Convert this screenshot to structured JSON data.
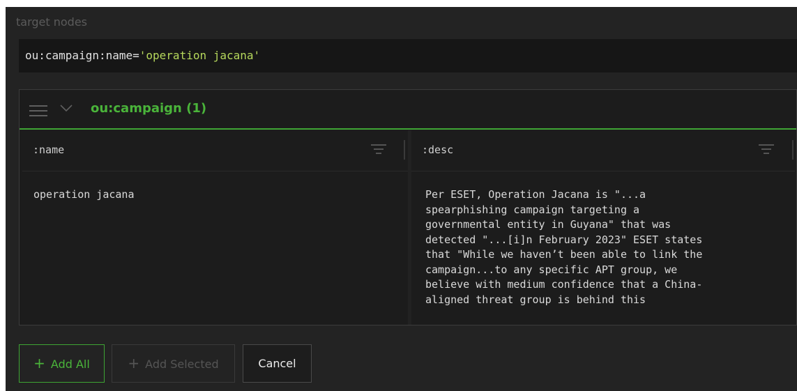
{
  "target_label": "target nodes",
  "query": {
    "prop": "ou:campaign:name",
    "op": "=",
    "value": "'operation jacana'"
  },
  "card": {
    "title": "ou:campaign (1)",
    "columns": [
      {
        "label": ":name"
      },
      {
        "label": ":desc"
      }
    ],
    "rows": [
      {
        "name": "operation jacana",
        "desc": "Per ESET, Operation Jacana is \"...a\nspearphishing campaign targeting a\ngovernmental entity in Guyana\" that was\ndetected \"...[i]n February 2023\" ESET states\nthat \"While we haven’t been able to link the\ncampaign...to any specific APT group, we\nbelieve with medium confidence that a China-\naligned threat group is behind this"
      }
    ]
  },
  "buttons": {
    "add_all": "Add All",
    "add_selected": "Add Selected",
    "cancel": "Cancel"
  },
  "colors": {
    "accent": "#4ab43a",
    "value": "#b6d85c",
    "panel": "#232323"
  }
}
